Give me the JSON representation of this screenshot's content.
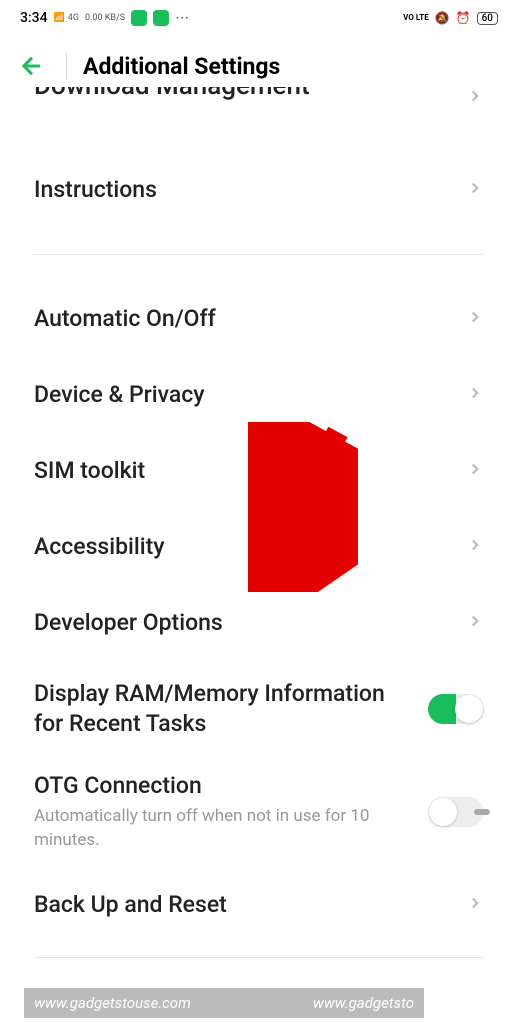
{
  "statusBar": {
    "time": "3:34",
    "signal": "4G",
    "speed": "0.00 KB/S",
    "volte": "VO LTE",
    "battery": "60"
  },
  "header": {
    "title": "Additional Settings"
  },
  "partialItem": {
    "label": "Download Management"
  },
  "items": {
    "instructions": "Instructions",
    "autoOnOff": "Automatic On/Off",
    "devicePrivacy": "Device & Privacy",
    "simToolkit": "SIM toolkit",
    "accessibility": "Accessibility",
    "devOptions": "Developer Options",
    "displayRam": "Display RAM/Memory Information for Recent Tasks",
    "otg": "OTG Connection",
    "otgSub": "Automatically turn off when not in use for 10 minutes.",
    "backup": "Back Up and Reset"
  },
  "watermark": {
    "left": "www.gadgetstouse.com",
    "right": "www.gadgetsto"
  }
}
